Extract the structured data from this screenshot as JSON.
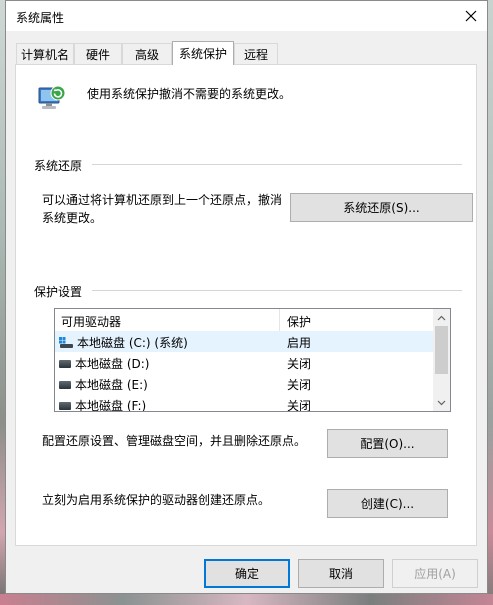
{
  "window": {
    "title": "系统属性"
  },
  "tabs": [
    {
      "label": "计算机名"
    },
    {
      "label": "硬件"
    },
    {
      "label": "高级"
    },
    {
      "label": "系统保护"
    },
    {
      "label": "远程"
    }
  ],
  "header": {
    "description": "使用系统保护撤消不需要的系统更改。"
  },
  "restore": {
    "section_label": "系统还原",
    "text_line1": "可以通过将计算机还原到上一个还原点，撤消",
    "text_line2": "系统更改。",
    "button_label": "系统还原(S)..."
  },
  "protection": {
    "section_label": "保护设置",
    "columns": [
      "可用驱动器",
      "保护"
    ],
    "drives": [
      {
        "name": "本地磁盘 (C:) (系统)",
        "status": "启用"
      },
      {
        "name": "本地磁盘 (D:)",
        "status": "关闭"
      },
      {
        "name": "本地磁盘 (E:)",
        "status": "关闭"
      },
      {
        "name": "本地磁盘 (F:)",
        "status": "关闭"
      }
    ],
    "configure_text": "配置还原设置、管理磁盘空间，并且删除还原点。",
    "configure_button": "配置(O)...",
    "create_text": "立刻为启用系统保护的驱动器创建还原点。",
    "create_button": "创建(C)..."
  },
  "footer": {
    "ok": "确定",
    "cancel": "取消",
    "apply": "应用(A)"
  },
  "colors": {
    "accent": "#0078d7",
    "selected_row": "#e5f3ff"
  }
}
